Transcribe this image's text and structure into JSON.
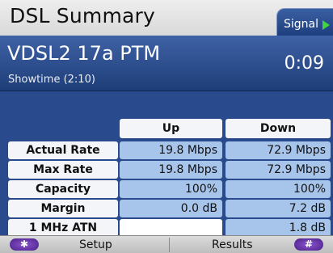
{
  "header": {
    "title": "DSL Summary",
    "tab_label": "Signal"
  },
  "subheader": {
    "mode": "VDSL2 17a PTM",
    "status": "Showtime (2:10)",
    "timer": "0:09"
  },
  "table": {
    "columns": [
      "Up",
      "Down"
    ],
    "rows": [
      {
        "label": "Actual Rate",
        "up": "19.8 Mbps",
        "down": "72.9 Mbps"
      },
      {
        "label": "Max Rate",
        "up": "19.8 Mbps",
        "down": "72.9 Mbps"
      },
      {
        "label": "Capacity",
        "up": "100%",
        "down": "100%"
      },
      {
        "label": "Margin",
        "up": "0.0 dB",
        "down": "7.2 dB"
      },
      {
        "label": "1 MHz ATN",
        "up": "",
        "down": "1.8 dB"
      }
    ]
  },
  "softkeys": {
    "left_symbol": "✱",
    "setup": "Setup",
    "results": "Results",
    "right_symbol": "#"
  },
  "colors": {
    "accent": "#294a8c",
    "value_cell": "#a7c4ea",
    "label_cell": "#f4f5f8",
    "signal_arrow": "#40d440"
  },
  "icons": {
    "signal_tab": "play-arrow-icon"
  }
}
